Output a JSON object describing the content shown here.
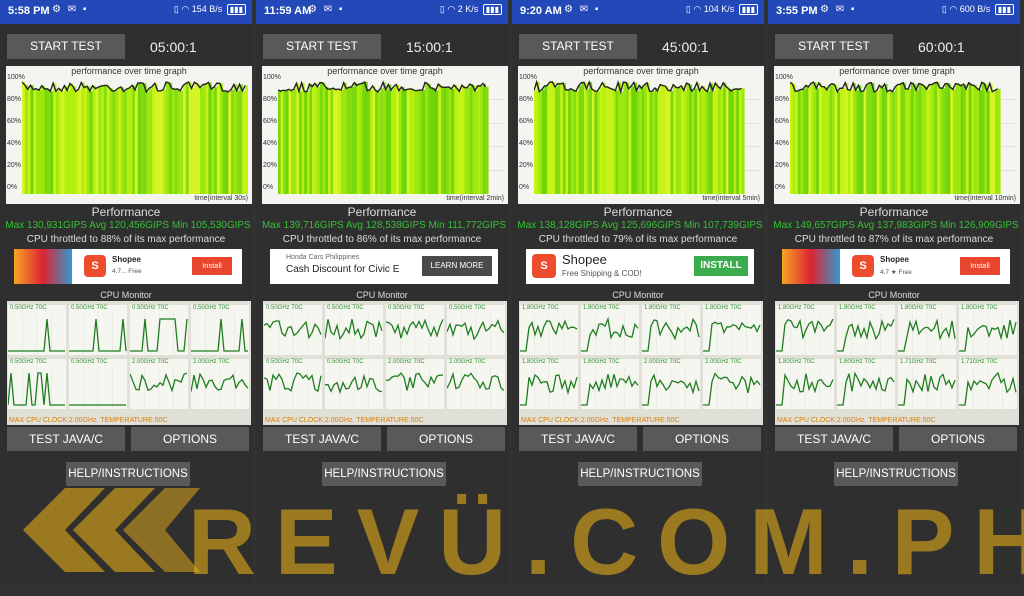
{
  "panels": [
    {
      "status_time": "5:58 PM",
      "status_right": "154 B/s",
      "battery": "",
      "start_label": "START TEST",
      "timer": "05:00:1",
      "graph_title": "performance over time graph",
      "interval": "time(interval 30s)",
      "perf_heading": "Performance",
      "perf_values": "Max 130,931GIPS  Avg 120,456GIPS  Min 105,530GIPS",
      "throttle": "CPU throttled to 88% of its max performance",
      "ad": {
        "brand": "Shopee",
        "sub": "4.7... Free",
        "cta": "Install",
        "style": "small"
      },
      "cpu_monitor": "CPU Monitor",
      "cores": [
        {
          "label": "0.50GHz   T0C"
        },
        {
          "label": "0.50GHz   T0C"
        },
        {
          "label": "0.50GHz   T0C"
        },
        {
          "label": "0.50GHz   T0C"
        },
        {
          "label": "0.50GHz   T0C"
        },
        {
          "label": "0.50GHz   T0C"
        },
        {
          "label": "2.00GHz   T0C"
        },
        {
          "label": "2.00GHz   T0C"
        }
      ],
      "max_clock": "MAX CPU CLOCK:2.00GHz, TEMPERATURE:50C",
      "java_label": "TEST JAVA/C",
      "options_label": "OPTIONS",
      "help_label": "HELP/INSTRUCTIONS",
      "fill": 1.0
    },
    {
      "status_time": "11:59 AM",
      "status_right": "2 K/s",
      "battery": "",
      "start_label": "START TEST",
      "timer": "15:00:1",
      "graph_title": "performance over time graph",
      "interval": "time(interval 2min)",
      "perf_heading": "Performance",
      "perf_values": "Max 139,716GIPS  Avg 128,538GIPS  Min 111,772GIPS",
      "throttle": "CPU throttled to 86% of its max performance",
      "ad": {
        "brand": "Honda Cars Philippines",
        "sub": "Cash Discount for Civic E",
        "cta": "LEARN MORE",
        "style": "honda"
      },
      "cpu_monitor": "CPU Monitor",
      "cores": [
        {
          "label": "0.50GHz   T0C"
        },
        {
          "label": "0.50GHz   T0C"
        },
        {
          "label": "0.50GHz   T0C"
        },
        {
          "label": "0.50GHz   T0C"
        },
        {
          "label": "0.50GHz   T0C"
        },
        {
          "label": "0.50GHz   T0C"
        },
        {
          "label": "2.00GHz   T0C"
        },
        {
          "label": "2.00GHz   T0C"
        }
      ],
      "max_clock": "MAX CPU CLOCK:2.00GHz, TEMPERATURE:50C",
      "java_label": "TEST JAVA/C",
      "options_label": "OPTIONS",
      "help_label": "HELP/INSTRUCTIONS",
      "fill": 0.93
    },
    {
      "status_time": "9:20 AM",
      "status_right": "104 K/s",
      "battery": "",
      "start_label": "START TEST",
      "timer": "45:00:1",
      "graph_title": "performance over time graph",
      "interval": "time(interval 5min)",
      "perf_heading": "Performance",
      "perf_values": "Max 138,128GIPS  Avg 125,696GIPS  Min 107,739GIPS",
      "throttle": "CPU throttled to 79% of its max performance",
      "ad": {
        "brand": "Shopee",
        "sub": "Free Shipping & COD!",
        "cta": "INSTALL",
        "style": "big"
      },
      "cpu_monitor": "CPU Monitor",
      "cores": [
        {
          "label": "1.80GHz   T0C"
        },
        {
          "label": "1.80GHz   T0C"
        },
        {
          "label": "1.80GHz   T0C"
        },
        {
          "label": "1.80GHz   T0C"
        },
        {
          "label": "1.80GHz   T0C"
        },
        {
          "label": "1.80GHz   T0C"
        },
        {
          "label": "2.00GHz   T0C"
        },
        {
          "label": "2.00GHz   T0C"
        }
      ],
      "max_clock": "MAX CPU CLOCK:2.00GHz, TEMPERATURE:50C",
      "java_label": "TEST JAVA/C",
      "options_label": "OPTIONS",
      "help_label": "HELP/INSTRUCTIONS",
      "fill": 0.93
    },
    {
      "status_time": "3:55 PM",
      "status_right": "600 B/s",
      "battery": "",
      "start_label": "START TEST",
      "timer": "60:00:1",
      "graph_title": "performance over time graph",
      "interval": "time(interval 10min)",
      "perf_heading": "Performance",
      "perf_values": "Max 149,657GIPS  Avg 137,983GIPS  Min 126,909GIPS",
      "throttle": "CPU throttled to 87% of its max performance",
      "ad": {
        "brand": "Shopee",
        "sub": "4.7 ★ Free",
        "cta": "Install",
        "style": "small2"
      },
      "cpu_monitor": "CPU Monitor",
      "cores": [
        {
          "label": "1.80GHz   T0C"
        },
        {
          "label": "1.80GHz   T0C"
        },
        {
          "label": "1.80GHz   T0C"
        },
        {
          "label": "1.80GHz   T0C"
        },
        {
          "label": "1.80GHz   T0C"
        },
        {
          "label": "1.80GHz   T0C"
        },
        {
          "label": "1.71GHz   T0C"
        },
        {
          "label": "1.71GHz   T0C"
        }
      ],
      "max_clock": "MAX CPU CLOCK:2.00GHz, TEMPERATURE:50C",
      "java_label": "TEST JAVA/C",
      "options_label": "OPTIONS",
      "help_label": "HELP/INSTRUCTIONS",
      "fill": 0.93
    }
  ],
  "y_ticks": [
    "100%",
    "80%",
    "60%",
    "40%",
    "20%",
    "0%"
  ],
  "watermark": "REVÜ.COM.PH",
  "colors": {
    "accent_green": "#35c035",
    "status_blue": "#2348b8",
    "watermark_gold": "#ffbe14",
    "ad_orange": "#ee4d2d"
  }
}
